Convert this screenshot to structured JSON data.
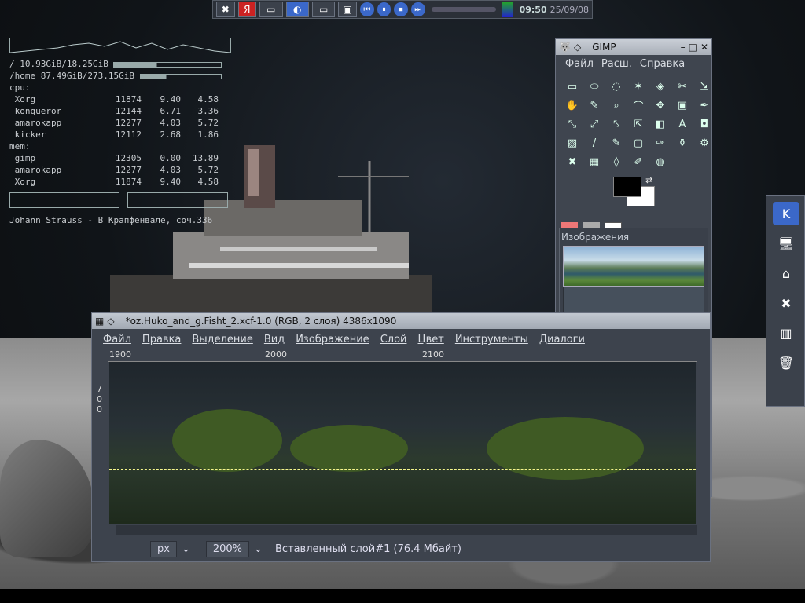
{
  "panel": {
    "clock": "09:50",
    "date": "25/09/08",
    "yandex": "Я"
  },
  "conky": {
    "root_fs": "/ 10.93GiB/18.25GiB",
    "home_fs": "/home 87.49GiB/273.15GiB",
    "cpu_label": "cpu:",
    "cpu_rows": [
      [
        "Xorg",
        "11874",
        "9.40",
        "4.58"
      ],
      [
        "konqueror",
        "12144",
        "6.71",
        "3.36"
      ],
      [
        "amarokapp",
        "12277",
        "4.03",
        "5.72"
      ],
      [
        "kicker",
        "12112",
        "2.68",
        "1.86"
      ]
    ],
    "mem_label": "mem:",
    "mem_rows": [
      [
        "gimp",
        "12305",
        "0.00",
        "13.89"
      ],
      [
        "amarokapp",
        "12277",
        "4.03",
        "5.72"
      ],
      [
        "Xorg",
        "11874",
        "9.40",
        "4.58"
      ]
    ],
    "now_playing": "Johann Strauss - B Крапфенвале, соч.336"
  },
  "toolbox": {
    "title": "GIMP",
    "menu": [
      "Файл",
      "Расш.",
      "Справка"
    ],
    "images_title": "Изображения"
  },
  "imagewin": {
    "title": "*oz.Huko_and_g.Fisht_2.xcf-1.0 (RGB, 2 слоя) 4386x1090",
    "menu": [
      "Файл",
      "Правка",
      "Выделение",
      "Вид",
      "Изображение",
      "Слой",
      "Цвет",
      "Инструменты",
      "Диалоги"
    ],
    "ruler": [
      "1900",
      "2000",
      "2100"
    ],
    "vruler": [
      "7",
      "0",
      "0"
    ],
    "unit": "px",
    "zoom": "200%",
    "status": "Вставленный слой#1 (76.4 Мбайт)"
  },
  "colors": {
    "accent": "#3b68c9"
  }
}
